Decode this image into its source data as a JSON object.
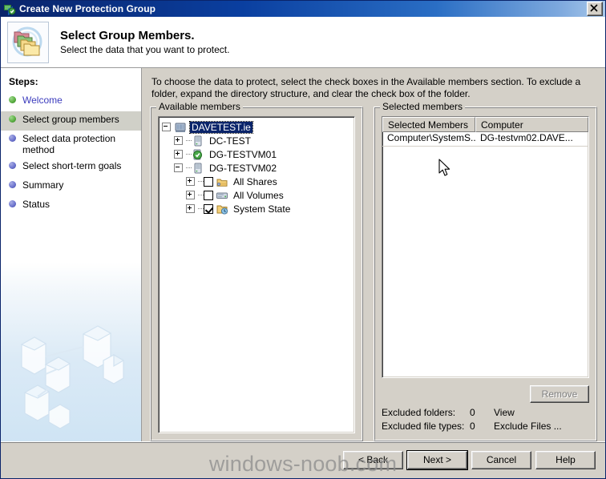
{
  "window": {
    "title": "Create New Protection Group",
    "close_label": "Close",
    "icon": "protection-group-icon"
  },
  "header": {
    "title": "Select Group Members.",
    "subtitle": "Select the data that you want to protect.",
    "icon": "folders-stack-icon"
  },
  "sidebar": {
    "title": "Steps:",
    "items": [
      {
        "label": "Welcome",
        "state": "done"
      },
      {
        "label": "Select group members",
        "state": "current"
      },
      {
        "label": "Select data protection method",
        "state": "pending"
      },
      {
        "label": "Select short-term goals",
        "state": "pending"
      },
      {
        "label": "Summary",
        "state": "pending"
      },
      {
        "label": "Status",
        "state": "pending"
      }
    ],
    "artwork": "servers-network-illustration"
  },
  "main": {
    "instructions": "To choose the data to protect, select the check boxes in the Available members section. To exclude a folder, expand the directory structure, and clear the check box of the folder.",
    "available": {
      "legend": "Available members",
      "tree": [
        {
          "label": "DAVETEST.ie",
          "level": 0,
          "expander": "minus",
          "checkbox": "none",
          "icon": "domain-icon",
          "selected": true
        },
        {
          "label": "DC-TEST",
          "level": 1,
          "expander": "plus",
          "checkbox": "none",
          "icon": "server-icon",
          "selected": false
        },
        {
          "label": "DG-TESTVM01",
          "level": 1,
          "expander": "plus",
          "checkbox": "none",
          "icon": "server-protected-icon",
          "selected": false
        },
        {
          "label": "DG-TESTVM02",
          "level": 1,
          "expander": "minus",
          "checkbox": "none",
          "icon": "server-icon",
          "selected": false
        },
        {
          "label": "All Shares",
          "level": 2,
          "expander": "plus",
          "checkbox": "unchecked",
          "icon": "shares-icon",
          "selected": false
        },
        {
          "label": "All Volumes",
          "level": 2,
          "expander": "plus",
          "checkbox": "unchecked",
          "icon": "volumes-icon",
          "selected": false
        },
        {
          "label": "System State",
          "level": 2,
          "expander": "plus",
          "checkbox": "checked",
          "icon": "system-state-icon",
          "selected": false
        }
      ]
    },
    "selected": {
      "legend": "Selected members",
      "columns": [
        "Selected Members",
        "Computer"
      ],
      "rows": [
        {
          "member": "Computer\\SystemS...",
          "computer": "DG-testvm02.DAVE..."
        }
      ],
      "remove_label": "Remove",
      "remove_disabled": true,
      "excluded_folders_label": "Excluded folders:",
      "excluded_folders_count": "0",
      "excluded_folders_action": "View",
      "excluded_filetypes_label": "Excluded file types:",
      "excluded_filetypes_count": "0",
      "excluded_filetypes_action": "Exclude Files ..."
    }
  },
  "footer": {
    "back": "< Back",
    "next": "Next >",
    "cancel": "Cancel",
    "help": "Help"
  },
  "watermark": "windows-noob.com",
  "colors": {
    "title_bar_start": "#0a246a",
    "title_bar_end": "#a8c8ea",
    "dialog_face": "#d4d0c8",
    "selection_blue": "#0a246a",
    "step_done": "#5cb043",
    "step_pending": "#6f76cf",
    "link_text": "#3b3bbd"
  }
}
